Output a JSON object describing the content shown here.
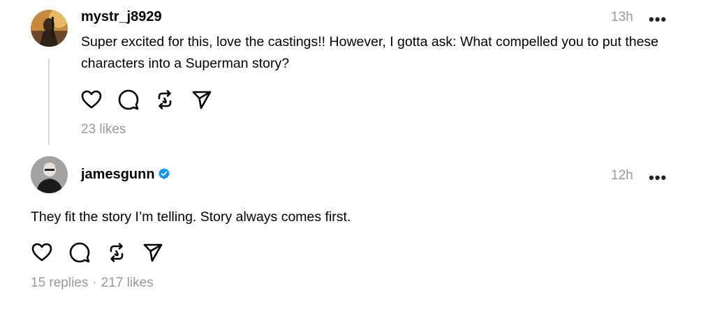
{
  "post1": {
    "username": "mystr_j8929",
    "time": "13h",
    "more_label": "•••",
    "text": "Super excited for this, love the castings!! However, I gotta ask: What compelled you to put these characters into a Superman story?",
    "likes": "23 likes",
    "icons": [
      "heart-icon",
      "comment-icon",
      "repost-icon",
      "share-icon"
    ]
  },
  "post2": {
    "username": "jamesgunn",
    "verified": true,
    "time": "12h",
    "more_label": "•••",
    "text": "They fit the story I’m telling. Story always comes first.",
    "replies": "15 replies",
    "separator": "·",
    "likes": "217 likes",
    "icons": [
      "heart-icon",
      "comment-icon",
      "repost-icon",
      "share-icon"
    ]
  },
  "colors": {
    "text": "#000000",
    "muted": "#999999",
    "thread_line": "#d9d9d9",
    "verified_blue": "#0095f6"
  }
}
